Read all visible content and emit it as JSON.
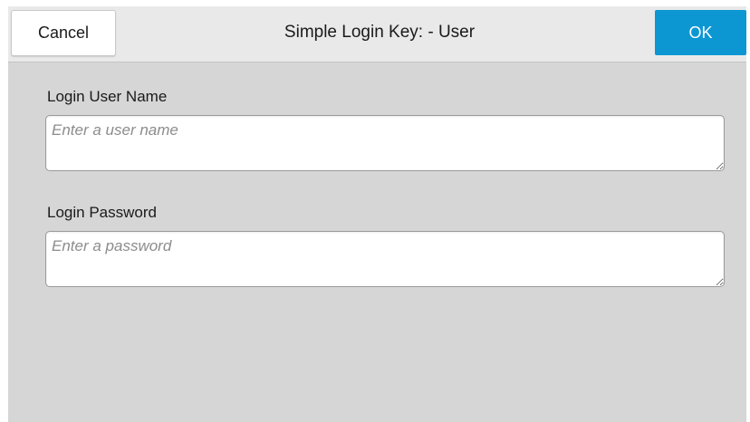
{
  "header": {
    "cancel_label": "Cancel",
    "title": "Simple Login Key: - User",
    "ok_label": "OK"
  },
  "form": {
    "username": {
      "label": "Login User Name",
      "value": "",
      "placeholder": "Enter a user name"
    },
    "password": {
      "label": "Login Password",
      "value": "",
      "placeholder": "Enter a password"
    }
  },
  "colors": {
    "accent": "#0c97d3",
    "background": "#d6d6d6",
    "header_background": "#e9e9e9"
  }
}
